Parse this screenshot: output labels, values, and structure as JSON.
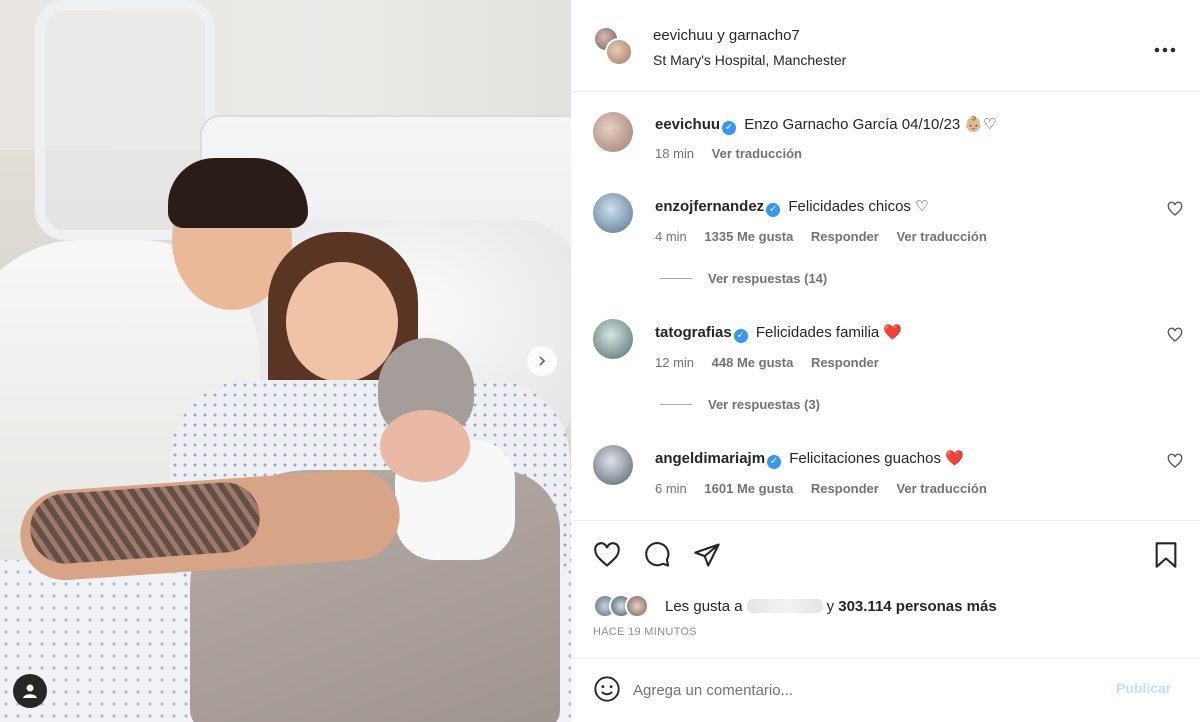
{
  "header": {
    "title": "eevichuu y garnacho7",
    "location": "St Mary's Hospital, Manchester",
    "more_label": "•••"
  },
  "caption": {
    "username": "eevichuu",
    "text": "Enzo Garnacho García 04/10/23 👶🏼♡",
    "time": "18 min",
    "translate": "Ver traducción"
  },
  "comments": [
    {
      "username": "enzojfernandez",
      "text": "Felicidades chicos ♡",
      "time": "4 min",
      "likes": "1335 Me gusta",
      "reply": "Responder",
      "translate": "Ver traducción",
      "replies": "Ver respuestas (14)"
    },
    {
      "username": "tatografias",
      "text": "Felicidades familia ❤️",
      "time": "12 min",
      "likes": "448 Me gusta",
      "reply": "Responder",
      "replies": "Ver respuestas (3)"
    },
    {
      "username": "angeldimariajm",
      "text": "Felicitaciones guachos ❤️",
      "time": "6 min",
      "likes": "1601 Me gusta",
      "reply": "Responder",
      "translate": "Ver traducción"
    }
  ],
  "likes_line": {
    "prefix": "Les gusta a",
    "connector": "y",
    "count": "303.114 personas más"
  },
  "time_ago": "HACE 19 MINUTOS",
  "add_comment": {
    "placeholder": "Agrega un comentario...",
    "publish": "Publicar"
  },
  "icons": {
    "like": "heart-icon",
    "comment": "comment-icon",
    "share": "share-icon",
    "save": "bookmark-icon",
    "emoji": "emoji-icon"
  },
  "colors": {
    "verified": "#3897f0",
    "red_heart": "#ed4956",
    "text": "#262626",
    "secondary": "#737373",
    "publish_disabled": "#c0dffd"
  }
}
